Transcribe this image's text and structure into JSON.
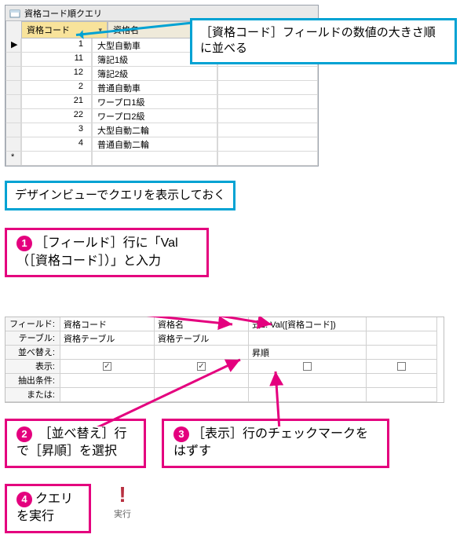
{
  "datasheet": {
    "tab_title": "資格コード順クエリ",
    "col1": "資格コード",
    "col2": "資格名",
    "rows": [
      {
        "code": "1",
        "name": "大型自動車"
      },
      {
        "code": "11",
        "name": "簿記1級"
      },
      {
        "code": "12",
        "name": "簿記2級"
      },
      {
        "code": "2",
        "name": "普通自動車"
      },
      {
        "code": "21",
        "name": "ワープロ1級"
      },
      {
        "code": "22",
        "name": "ワープロ2級"
      },
      {
        "code": "3",
        "name": "大型自動二輪"
      },
      {
        "code": "4",
        "name": "普通自動二輪"
      }
    ],
    "new_row_marker": "*"
  },
  "callout1": "［資格コード］フィールドの数値の大きさ順に並べる",
  "callout2": "デザインビューでクエリを表示しておく",
  "step1": "［フィールド］行に「Val（［資格コード］）」と入力",
  "step2": "［並べ替え］行で［昇順］を選択",
  "step3": "［表示］行のチェックマークをはずす",
  "step4": "クエリを実行",
  "design": {
    "labels": {
      "field": "フィールド:",
      "table": "テーブル:",
      "sort": "並べ替え:",
      "show": "表示:",
      "criteria": "抽出条件:",
      "or": "または:"
    },
    "cols": [
      {
        "field": "資格コード",
        "table": "資格テーブル",
        "sort": "",
        "show": true
      },
      {
        "field": "資格名",
        "table": "資格テーブル",
        "sort": "",
        "show": true
      },
      {
        "field": "式1: Val([資格コード])",
        "table": "",
        "sort": "昇順",
        "show": false
      }
    ]
  },
  "runbtn": {
    "exclaim": "!",
    "label": "実行"
  }
}
